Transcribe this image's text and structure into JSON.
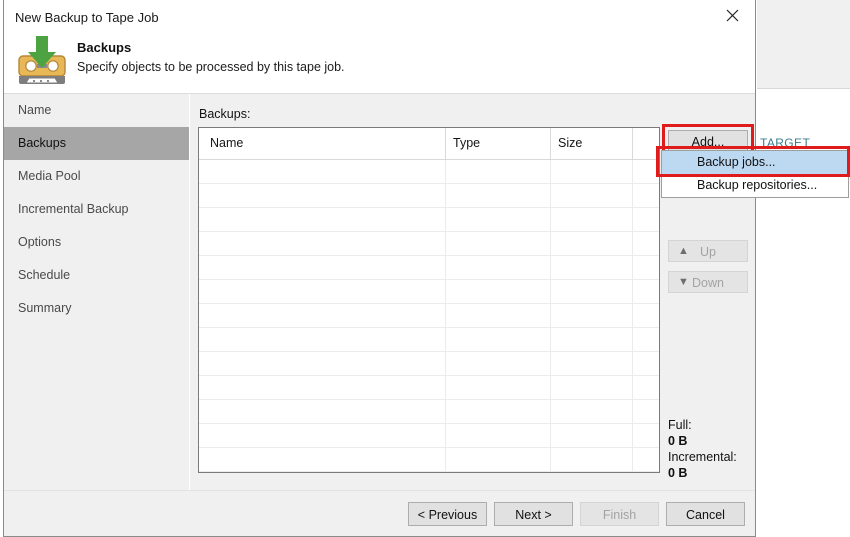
{
  "window": {
    "title": "New Backup to Tape Job",
    "close_icon": "close-icon"
  },
  "header": {
    "icon": "tape-backup-icon",
    "title": "Backups",
    "subtitle": "Specify objects to be processed by this tape job."
  },
  "sidebar": {
    "items": [
      {
        "label": "Name",
        "active": false
      },
      {
        "label": "Backups",
        "active": true
      },
      {
        "label": "Media Pool",
        "active": false
      },
      {
        "label": "Incremental Backup",
        "active": false
      },
      {
        "label": "Options",
        "active": false
      },
      {
        "label": "Schedule",
        "active": false
      },
      {
        "label": "Summary",
        "active": false
      }
    ]
  },
  "main": {
    "list_label": "Backups:",
    "columns": [
      "Name",
      "Type",
      "Size"
    ],
    "rows": [],
    "buttons": {
      "add": "Add...",
      "up": "Up",
      "down": "Down",
      "up_icon": "arrow-up-icon",
      "down_icon": "arrow-down-icon"
    },
    "sizes": {
      "full_label": "Full:",
      "full_value": "0 B",
      "incremental_label": "Incremental:",
      "incremental_value": "0 B"
    }
  },
  "menu": {
    "items": [
      {
        "label": "Backup jobs...",
        "highlighted": true
      },
      {
        "label": "Backup repositories...",
        "highlighted": false
      }
    ]
  },
  "footer": {
    "previous": "< Previous",
    "next": "Next >",
    "finish": "Finish",
    "cancel": "Cancel"
  },
  "background": {
    "target_label": "TARGET"
  },
  "colors": {
    "highlight_ring": "#e01b1b",
    "menu_highlight": "#bdd9f2",
    "nav_active": "#a6a6a6",
    "target_text": "#3c7b8e",
    "tape_body": "#e8b857",
    "arrow_green": "#4da341"
  }
}
